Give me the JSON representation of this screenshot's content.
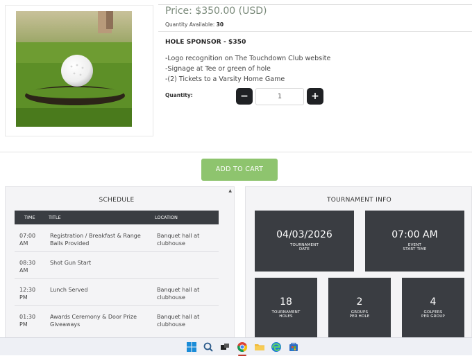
{
  "product": {
    "price": "Price: $350.00 (USD)",
    "qty_available_label": "Quantity Available:",
    "qty_available_value": "30",
    "title": "HOLE SPONSOR - $350",
    "benefits": [
      "-Logo recognition on The Touchdown Club website",
      "-Signage at Tee or green of hole",
      "-(2) Tickets to a Varsity Home Game"
    ],
    "quantity_label": "Quantity:",
    "quantity_value": "1",
    "decrement_symbol": "−",
    "increment_symbol": "+",
    "add_to_cart": "ADD TO CART"
  },
  "schedule": {
    "title": "SCHEDULE",
    "columns": [
      "TIME",
      "TITLE",
      "LOCATION"
    ],
    "rows": [
      {
        "time": [
          "07:00",
          "AM"
        ],
        "title": [
          "Registration / Breakfast & Range",
          "Balls Provided"
        ],
        "location": [
          "Banquet hall at",
          "clubhouse"
        ]
      },
      {
        "time": [
          "08:30",
          "AM"
        ],
        "title": [
          "Shot Gun Start"
        ],
        "location": []
      },
      {
        "time": [
          "12:30",
          "PM"
        ],
        "title": [
          "Lunch Served"
        ],
        "location": [
          "Banquet hall at",
          "clubhouse"
        ]
      },
      {
        "time": [
          "01:30",
          "PM"
        ],
        "title": [
          "Awards Ceremony & Door Prize",
          "Giveaways"
        ],
        "location": [
          "Banquet hall at",
          "clubhouse"
        ]
      }
    ]
  },
  "tournament": {
    "title": "TOURNAMENT INFO",
    "date_value": "04/03/2026",
    "date_label": [
      "TOURNAMENT",
      "DATE"
    ],
    "start_value": "07:00 AM",
    "start_label": [
      "EVENT",
      "START TIME"
    ],
    "holes_value": "18",
    "holes_label": [
      "TOURNAMENT",
      "HOLES"
    ],
    "groups_value": "2",
    "groups_label": [
      "GROUPS",
      "PER HOLE"
    ],
    "golfers_value": "4",
    "golfers_label": [
      "GOLFERS",
      "PER GROUP"
    ]
  },
  "colors": {
    "accent_green": "#8ec46e",
    "tile_dark": "#3a3d42",
    "button_dark": "#1f2124"
  },
  "taskbar": {
    "icons": [
      "windows-start-icon",
      "search-icon",
      "task-view-icon",
      "chrome-icon",
      "file-explorer-icon",
      "edge-icon",
      "store-icon"
    ]
  }
}
